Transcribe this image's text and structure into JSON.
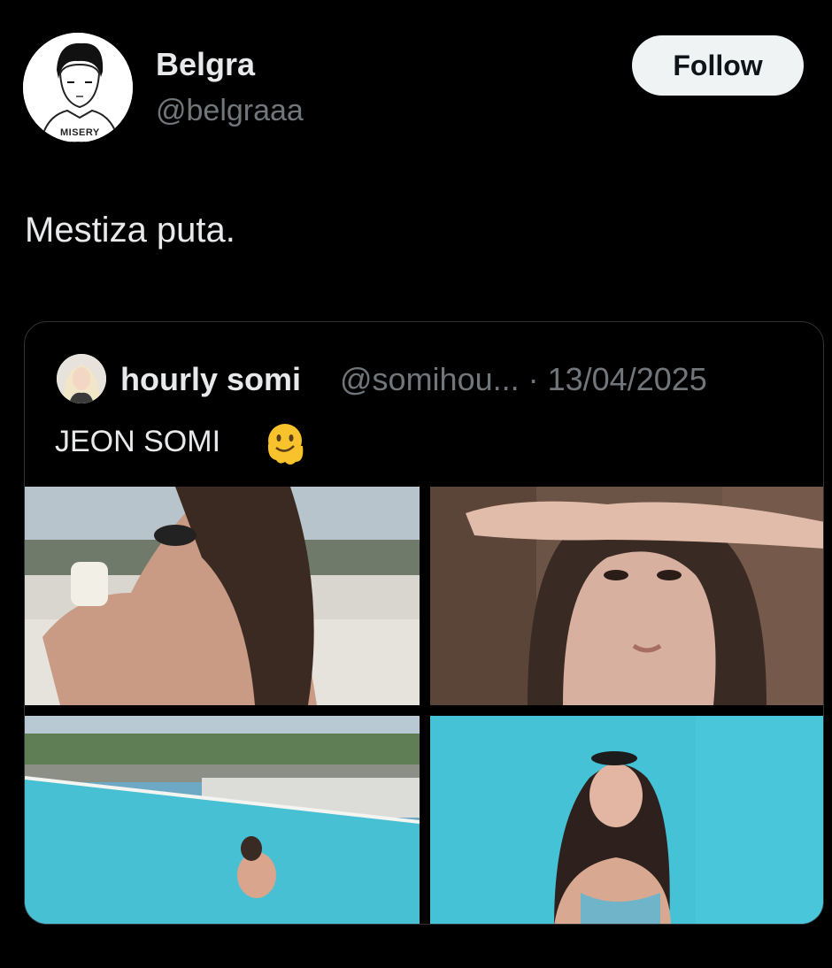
{
  "tweet": {
    "author_name": "Belgra",
    "author_handle": "@belgraaa",
    "avatar_text": "MISERY",
    "follow_label": "Follow",
    "text": "Mestiza puta."
  },
  "quoted": {
    "author_name": "hourly somi",
    "author_handle_date": "@somihou... · 13/04/2025",
    "text": "JEON SOMI",
    "emoji": "melting-face-icon"
  },
  "media": [
    {
      "name": "photo-pool-sunglasses"
    },
    {
      "name": "photo-closeup-hand"
    },
    {
      "name": "photo-infinity-pool"
    },
    {
      "name": "photo-pool-water"
    }
  ],
  "colors": {
    "background": "#000000",
    "text_primary": "#e7e9ea",
    "text_secondary": "#71767b",
    "border": "#2f3336",
    "button_bg": "#eff3f4"
  }
}
